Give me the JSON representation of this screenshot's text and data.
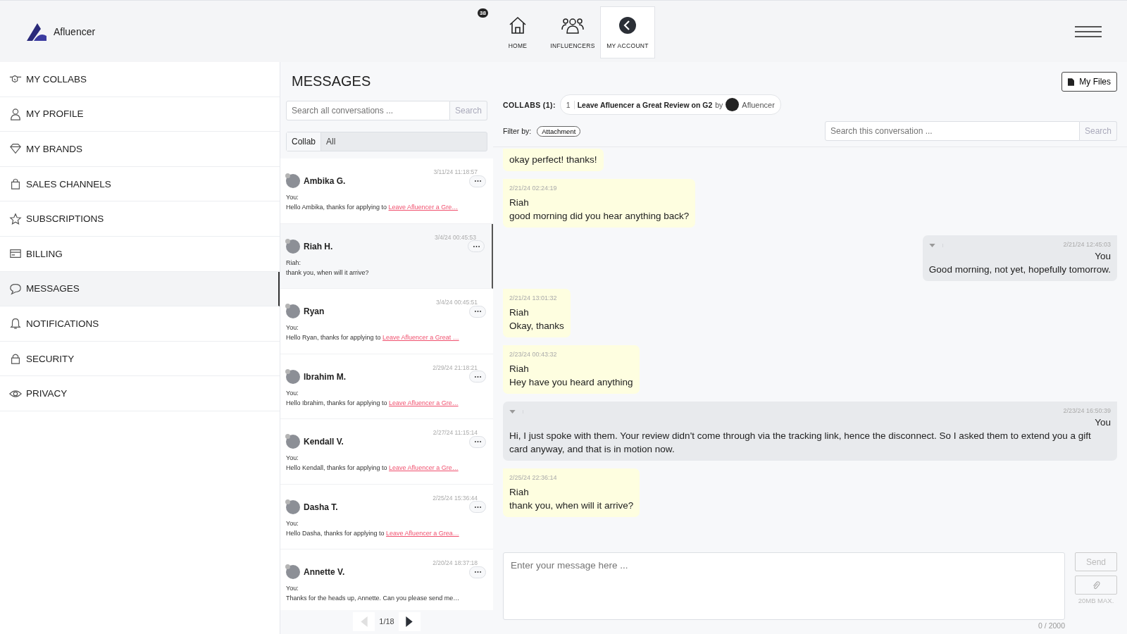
{
  "brand": {
    "name": "Afluencer"
  },
  "nav": [
    {
      "label": "HOME",
      "badge": "38",
      "selected": false
    },
    {
      "label": "INFLUENCERS",
      "selected": false
    },
    {
      "label": "MY ACCOUNT",
      "selected": true
    }
  ],
  "sidebar": {
    "items": [
      {
        "label": "MY COLLABS",
        "selected": false
      },
      {
        "label": "MY PROFILE",
        "selected": false
      },
      {
        "label": "MY BRANDS",
        "selected": false
      },
      {
        "label": "SALES CHANNELS",
        "selected": false
      },
      {
        "label": "SUBSCRIPTIONS",
        "selected": false
      },
      {
        "label": "BILLING",
        "selected": false
      },
      {
        "label": "MESSAGES",
        "selected": true
      },
      {
        "label": "NOTIFICATIONS",
        "selected": false
      },
      {
        "label": "SECURITY",
        "selected": false
      },
      {
        "label": "PRIVACY",
        "selected": false
      }
    ]
  },
  "page_title": "MESSAGES",
  "conversations": {
    "search": {
      "placeholder": "Search all conversations ...",
      "button": "Search"
    },
    "filter": {
      "label": "Collab",
      "value": "All"
    },
    "items": [
      {
        "name": "Ambika G.",
        "time": "3/11/24 11:18:57",
        "sender": "You:",
        "preview": "Hello Ambika, thanks for applying to ",
        "link": "Leave Afluencer a Gre…",
        "selected": false
      },
      {
        "name": "Riah H.",
        "time": "3/4/24 00:45:53",
        "sender": "Riah:",
        "preview": "thank you, when will it arrive?",
        "selected": true
      },
      {
        "name": "Ryan",
        "time": "3/4/24 00:45:51",
        "sender": "You:",
        "preview": "Hello Ryan, thanks for applying to ",
        "link": "Leave Afluencer a Great …",
        "selected": false
      },
      {
        "name": "Ibrahim M.",
        "time": "2/29/24 21:18:21",
        "sender": "You:",
        "preview": "Hello Ibrahim, thanks for applying to ",
        "link": "Leave Afluencer a Gre…",
        "selected": false
      },
      {
        "name": "Kendall V.",
        "time": "2/27/24 11:15:14",
        "sender": "You:",
        "preview": "Hello Kendall, thanks for applying to ",
        "link": "Leave Afluencer a Gre…",
        "selected": false
      },
      {
        "name": "Dasha T.",
        "time": "2/25/24 15:36:44",
        "sender": "You:",
        "preview": "Hello Dasha, thanks for applying to ",
        "link": "Leave Afluencer a Grea…",
        "selected": false
      },
      {
        "name": "Annette V.",
        "time": "2/20/24 18:37:18",
        "sender": "You:",
        "preview": "Thanks for the heads up, Annette. Can you please send me…",
        "selected": false
      }
    ],
    "pagination": {
      "page": "1/18",
      "prev_disabled": true,
      "next_disabled": false
    }
  },
  "chat": {
    "my_files": "My Files",
    "collabs_label": "COLLABS (1):",
    "collab": {
      "index": "1",
      "title": "Leave Afluencer a Great Review on G2",
      "by": "by",
      "brand": "Afluencer"
    },
    "filter_label": "Filter by:",
    "filter_tag": "Attachment",
    "search": {
      "placeholder": "Search this conversation ...",
      "button": "Search"
    },
    "messages": [
      {
        "kind": "in",
        "text": "okay perfect! thanks!"
      },
      {
        "kind": "in",
        "time": "2/21/24 02:24:19",
        "sender": "Riah",
        "text": "good morning did you hear anything back?"
      },
      {
        "kind": "out",
        "time": "2/21/24 12:45:03",
        "sender": "You",
        "text": "Good morning, not yet, hopefully tomorrow."
      },
      {
        "kind": "in",
        "time": "2/21/24 13:01:32",
        "sender": "Riah",
        "text": "Okay, thanks"
      },
      {
        "kind": "in",
        "time": "2/23/24 00:43:32",
        "sender": "Riah",
        "text": "Hey have you heard anything"
      },
      {
        "kind": "out",
        "time": "2/23/24 16:50:39",
        "sender": "You",
        "text": "Hi, I just spoke with them. Your review didn't come through via the tracking link, hence the disconnect. So I asked them to extend you a gift card anyway, and that is in motion now."
      },
      {
        "kind": "in",
        "time": "2/25/24 22:36:14",
        "sender": "Riah",
        "text": "thank you, when will it arrive?"
      }
    ],
    "composer": {
      "placeholder": "Enter your message here ...",
      "counter": "0 / 2000",
      "send": "Send",
      "send_disabled": true,
      "size_limit": "20MB MAX."
    }
  }
}
